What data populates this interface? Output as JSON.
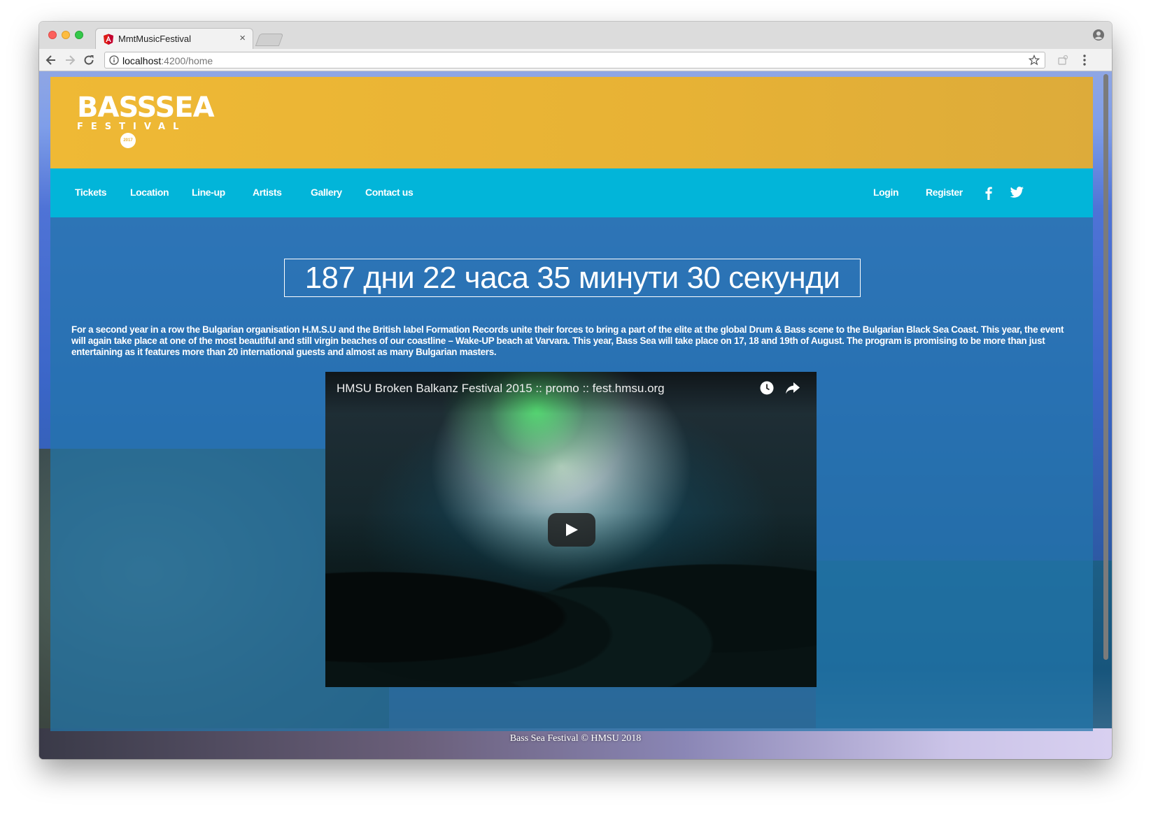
{
  "browser": {
    "tab_title": "MmtMusicFestival",
    "tab_close": "×",
    "url_host": "localhost",
    "url_path": ":4200/home"
  },
  "logo": {
    "main": "BASSSEA",
    "sub": "FESTIVAL",
    "year": "2017"
  },
  "nav": {
    "left": [
      "Tickets",
      "Location",
      "Line-up",
      "Artists",
      "Gallery",
      "Contact us"
    ],
    "login": "Login",
    "register": "Register",
    "social_icons": [
      "facebook-icon",
      "twitter-icon"
    ]
  },
  "countdown": "187 дни 22 часа 35 минути 30 секунди",
  "intro": "For a second year in a row the Bulgarian organisation H.M.S.U and the British label Formation Records unite their forces to bring a part of the elite at the global Drum & Bass scene to the Bulgarian Black Sea Coast. This year, the event will again take place at one of the most beautiful and still virgin beaches of our coastline – Wake-UP beach at Varvara. This year, Bass Sea will take place on 17, 18 and 19th of August. The program is promising to be more than just entertaining as it features more than 20 international guests and almost as many Bulgarian masters.",
  "video": {
    "title": "HMSU Broken Balkanz Festival 2015 :: promo :: fest.hmsu.org",
    "icons": [
      "clock-icon",
      "share-icon",
      "play-icon"
    ]
  },
  "footer": "Bass Sea Festival © HMSU 2018",
  "colors": {
    "header_yellow": "#e7b235",
    "nav_cyan": "#02b5d9",
    "content_overlay": "#2176aa"
  }
}
